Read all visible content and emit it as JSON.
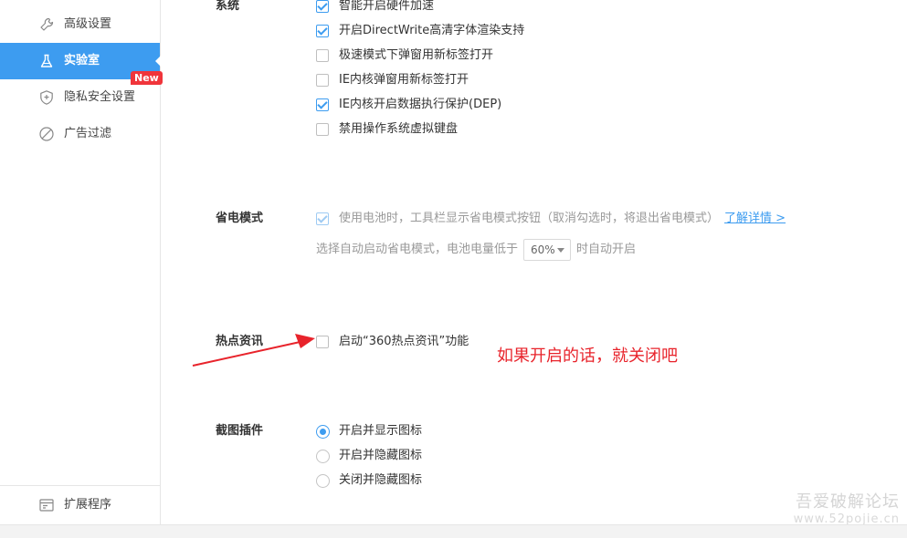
{
  "sidebar": {
    "items": [
      {
        "label": "高级设置",
        "icon": "wrench-icon"
      },
      {
        "label": "实验室",
        "icon": "flask-icon",
        "active": true,
        "badge": "New"
      },
      {
        "label": "隐私安全设置",
        "icon": "shield-icon"
      },
      {
        "label": "广告过滤",
        "icon": "ban-icon"
      }
    ],
    "footer": {
      "label": "扩展程序",
      "icon": "extensions-icon"
    }
  },
  "sections": {
    "system": {
      "title": "系统",
      "options": [
        {
          "label": "智能开启硬件加速",
          "checked": true
        },
        {
          "label": "开启DirectWrite高清字体渲染支持",
          "checked": true
        },
        {
          "label": "极速模式下弹窗用新标签打开",
          "checked": false
        },
        {
          "label": "IE内核弹窗用新标签打开",
          "checked": false
        },
        {
          "label": "IE内核开启数据执行保护(DEP)",
          "checked": true
        },
        {
          "label": "禁用操作系统虚拟键盘",
          "checked": false
        }
      ]
    },
    "power": {
      "title": "省电模式",
      "option": "使用电池时，工具栏显示省电模式按钮（取消勾选时，将退出省电模式）",
      "link": "了解详情 >",
      "auto_prefix": "选择自动启动省电模式，电池电量低于",
      "select_value": "60%",
      "auto_suffix": "时自动开启"
    },
    "hotnews": {
      "title": "热点资讯",
      "option": "启动“360热点资讯”功能",
      "checked": false
    },
    "screenshot": {
      "title": "截图插件",
      "options": [
        {
          "label": "开启并显示图标",
          "checked": true
        },
        {
          "label": "开启并隐藏图标",
          "checked": false
        },
        {
          "label": "关闭并隐藏图标",
          "checked": false
        }
      ]
    }
  },
  "annotation": {
    "text": "如果开启的话，就关闭吧",
    "color": "#e8232b"
  },
  "watermark": {
    "line1": "吾爱破解论坛",
    "line2": "www.52pojie.cn"
  },
  "colors": {
    "accent": "#3d9cf0",
    "badge": "#f0353b"
  }
}
